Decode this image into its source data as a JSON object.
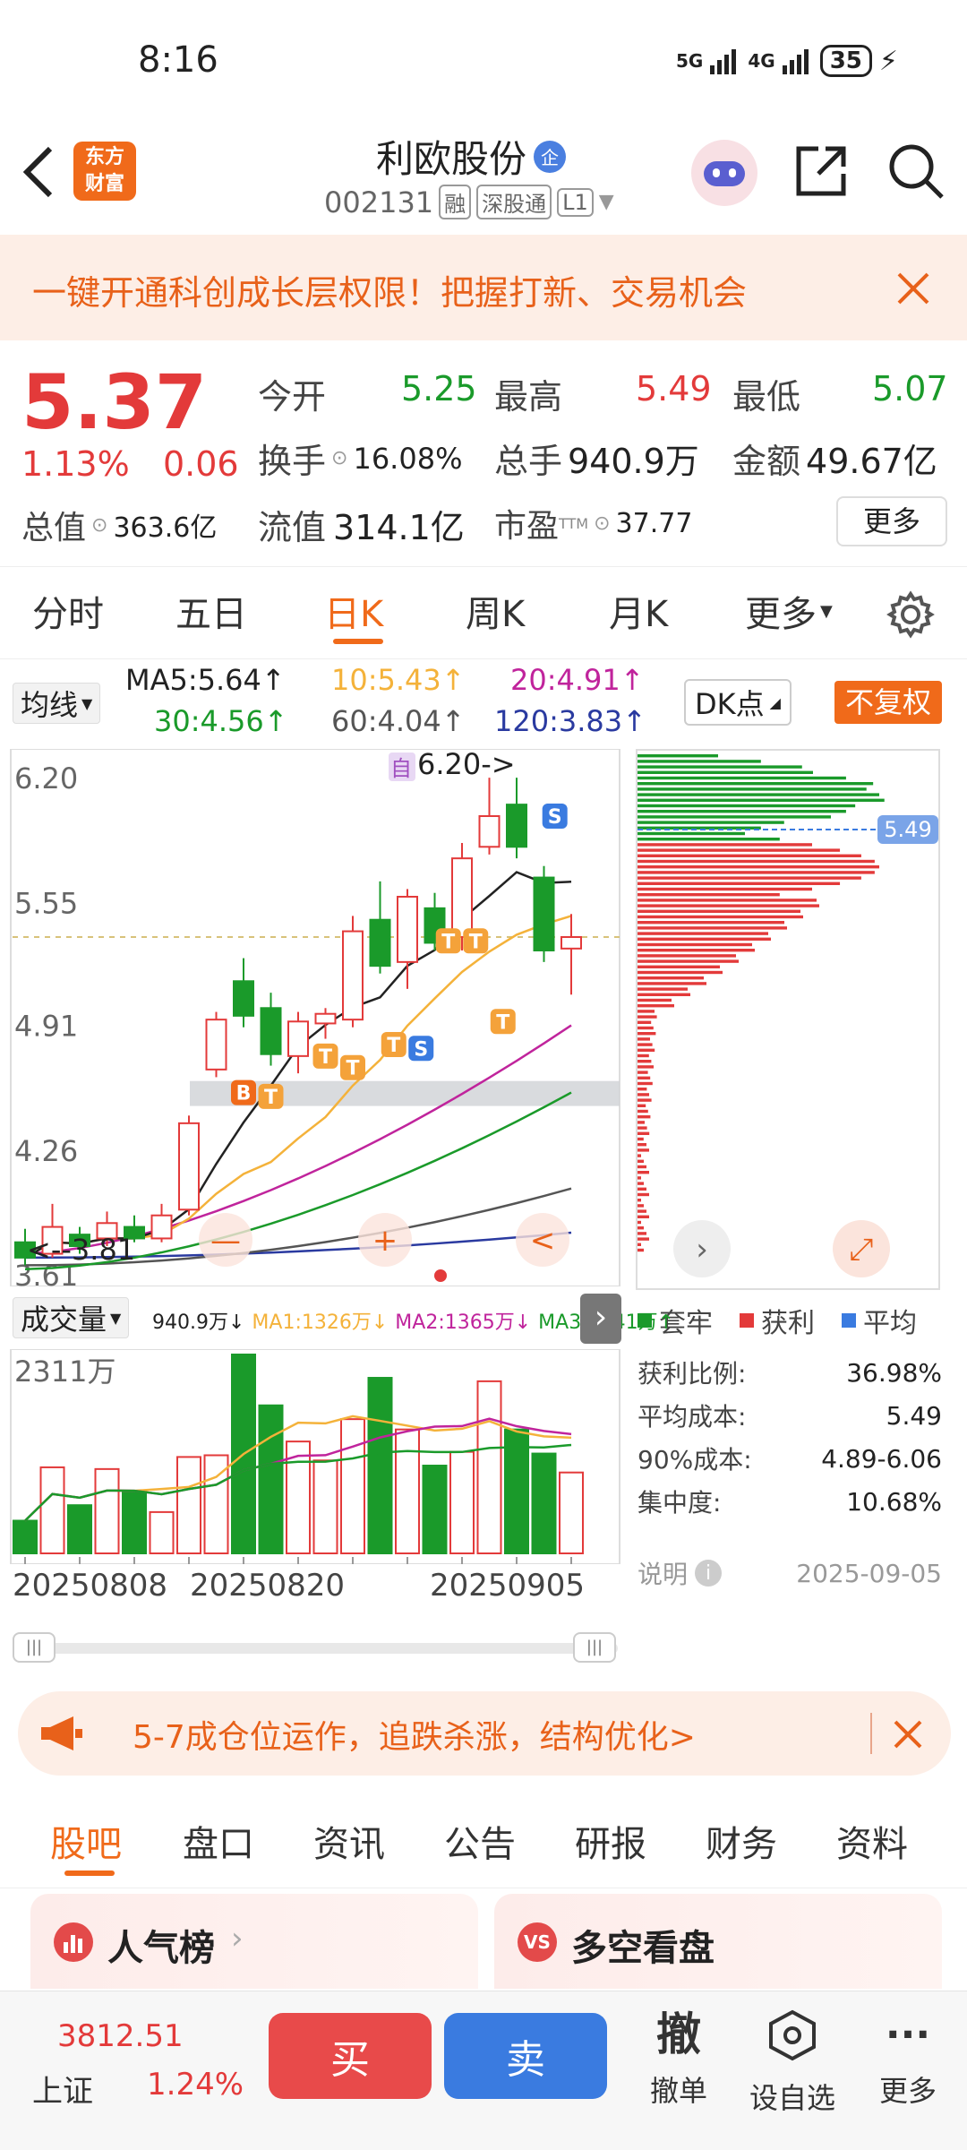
{
  "status": {
    "time": "8:16",
    "net1": "5G",
    "net2": "4G",
    "battery": "35"
  },
  "header": {
    "title": "利欧股份",
    "title_badge": "企",
    "code": "002131",
    "tags": [
      "融",
      "深股通",
      "L1"
    ],
    "logo_text": [
      "东方",
      "财富"
    ]
  },
  "promo": {
    "text": "一键开通科创成长层权限！把握打新、交易机会"
  },
  "quote": {
    "price": "5.37",
    "change_pct": "1.13%",
    "change": "0.06",
    "open_label": "今开",
    "open": "5.25",
    "high_label": "最高",
    "high": "5.49",
    "low_label": "最低",
    "low": "5.07",
    "turnover_label": "换手",
    "turnover": "16.08%",
    "volume_label": "总手",
    "volume": "940.9万",
    "amount_label": "金额",
    "amount": "49.67亿",
    "mcap_label": "总值",
    "mcap": "363.6亿",
    "float_label": "流值",
    "float": "314.1亿",
    "pe_label": "市盈",
    "pe_sup": "TTM",
    "pe": "37.77",
    "more": "更多"
  },
  "ktabs": {
    "items": [
      "分时",
      "五日",
      "日K",
      "周K",
      "月K",
      "更多"
    ],
    "active": "日K"
  },
  "ma_bar": {
    "selector": "均线",
    "ma5": "MA5:5.64↑",
    "ma10": "10:5.43↑",
    "ma20": "20:4.91↑",
    "ma30": "30:4.56↑",
    "ma60": "60:4.04↑",
    "ma120": "120:3.83↑",
    "dk": "DK点",
    "fq": "不复权"
  },
  "kline": {
    "y_labels": [
      "6.20",
      "5.55",
      "4.91",
      "4.26",
      "3.61"
    ],
    "high_mark": "6.20->",
    "low_mark": "<--3.81",
    "self_mark": "自",
    "cost_price": "5.49",
    "candles": [
      {
        "o": 3.78,
        "c": 3.7,
        "h": 3.85,
        "l": 3.66
      },
      {
        "o": 3.72,
        "c": 3.86,
        "h": 3.98,
        "l": 3.7
      },
      {
        "o": 3.82,
        "c": 3.76,
        "h": 3.86,
        "l": 3.72
      },
      {
        "o": 3.8,
        "c": 3.88,
        "h": 3.94,
        "l": 3.76
      },
      {
        "o": 3.86,
        "c": 3.8,
        "h": 3.92,
        "l": 3.78
      },
      {
        "o": 3.8,
        "c": 3.92,
        "h": 3.98,
        "l": 3.78
      },
      {
        "o": 3.95,
        "c": 4.4,
        "h": 4.44,
        "l": 3.92
      },
      {
        "o": 4.68,
        "c": 4.94,
        "h": 4.98,
        "l": 4.64
      },
      {
        "o": 5.14,
        "c": 4.96,
        "h": 5.26,
        "l": 4.9
      },
      {
        "o": 5.0,
        "c": 4.76,
        "h": 5.08,
        "l": 4.7
      },
      {
        "o": 4.75,
        "c": 4.93,
        "h": 4.98,
        "l": 4.66
      },
      {
        "o": 4.92,
        "c": 4.97,
        "h": 5.0,
        "l": 4.84
      },
      {
        "o": 4.94,
        "c": 5.4,
        "h": 5.48,
        "l": 4.9
      },
      {
        "o": 5.46,
        "c": 5.22,
        "h": 5.66,
        "l": 5.18
      },
      {
        "o": 5.24,
        "c": 5.58,
        "h": 5.62,
        "l": 5.1
      },
      {
        "o": 5.52,
        "c": 5.34,
        "h": 5.6,
        "l": 5.3
      },
      {
        "o": 5.37,
        "c": 5.78,
        "h": 5.86,
        "l": 5.3
      },
      {
        "o": 5.84,
        "c": 6.0,
        "h": 6.2,
        "l": 5.8
      },
      {
        "o": 6.06,
        "c": 5.84,
        "h": 6.2,
        "l": 5.78
      },
      {
        "o": 5.68,
        "c": 5.3,
        "h": 5.74,
        "l": 5.24
      },
      {
        "o": 5.31,
        "c": 5.37,
        "h": 5.49,
        "l": 5.07
      }
    ],
    "signals": [
      "B",
      "T",
      "T",
      "T",
      "T",
      "S",
      "T",
      "T",
      "T",
      "S"
    ],
    "buttons": [
      "—",
      "+",
      "<"
    ]
  },
  "chip": {
    "legend": [
      "套牢",
      "获利",
      "平均"
    ],
    "rows": [
      {
        "label": "获利比例:",
        "value": "36.98%"
      },
      {
        "label": "平均成本:",
        "value": "5.49"
      },
      {
        "label": "90%成本:",
        "value": "4.89-6.06"
      },
      {
        "label": "集中度:",
        "value": "10.68%"
      }
    ],
    "note": "说明",
    "date": "2025-09-05"
  },
  "volume": {
    "selector": "成交量",
    "vol": "940.9万↓",
    "ma1": "MA1:1326万↓",
    "ma2": "MA2:1365万↓",
    "ma3": "MA3:1241万↑",
    "max_label": "2311万",
    "bars": [
      380,
      1000,
      560,
      980,
      720,
      480,
      1120,
      1140,
      2311,
      1720,
      1300,
      1080,
      1560,
      2040,
      1440,
      1020,
      1180,
      2000,
      1440,
      1160,
      940
    ],
    "dates": [
      "20250808",
      "20250820",
      "20250905"
    ]
  },
  "notice": {
    "text": "5-7成仓位运作，追跌杀涨，结构优化>"
  },
  "btabs": {
    "items": [
      "股吧",
      "盘口",
      "资讯",
      "公告",
      "研报",
      "财务",
      "资料"
    ],
    "active": "股吧"
  },
  "cards": {
    "left": "人气榜",
    "right": "多空看盘"
  },
  "bottom": {
    "index_value": "3812.51",
    "index_name": "上证",
    "index_pct": "1.24%",
    "buy": "买",
    "sell": "卖",
    "cancel_icon": "撤",
    "cancel": "撤单",
    "watch": "设自选",
    "more": "更多"
  },
  "colors": {
    "up": "#e33a3a",
    "down": "#1a9a2a",
    "accent": "#f06a1a",
    "blue": "#3a7be0"
  }
}
